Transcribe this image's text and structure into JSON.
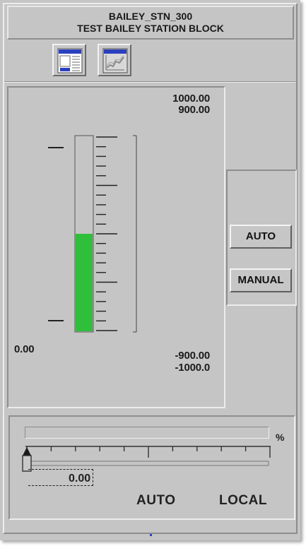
{
  "header": {
    "line1": "BAILEY_STN_300",
    "line2": "TEST BAILEY STATION BLOCK"
  },
  "toolbar": {
    "buttons": [
      {
        "name": "faceplate-detail-icon"
      },
      {
        "name": "trend-chart-icon"
      }
    ]
  },
  "bargraph": {
    "scale_top_1": "1000.00",
    "scale_top_2": "900.00",
    "scale_bottom_1": "-900.00",
    "scale_bottom_2": "-1000.0",
    "current_value": "0.00",
    "fill_fraction": 0.5,
    "fill_color": "#2fbf3a"
  },
  "mode_buttons": {
    "auto_label": "AUTO",
    "manual_label": "MANUAL"
  },
  "output": {
    "unit": "%",
    "value": "0.00",
    "slider_fraction": 0.0
  },
  "status": {
    "mode": "AUTO",
    "location": "LOCAL"
  }
}
